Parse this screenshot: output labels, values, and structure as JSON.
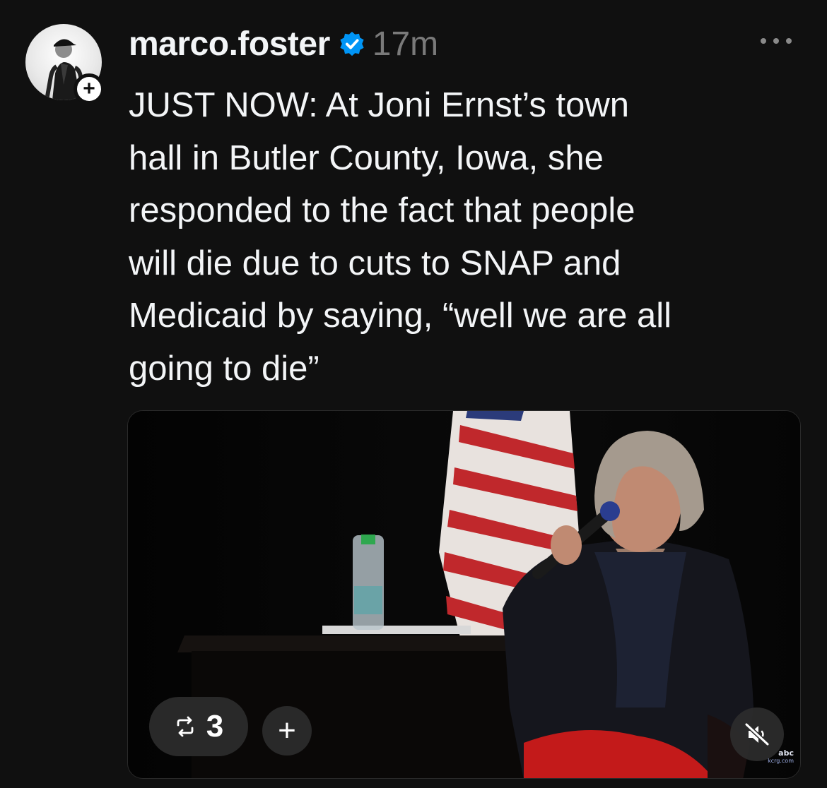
{
  "author": {
    "username": "marco.foster",
    "verified": true,
    "time": "17m",
    "avatar_icon": "user-avatar",
    "follow_icon": "plus-icon"
  },
  "post": {
    "text": "JUST NOW: At Joni Ernst’s town\nhall in Butler County, Iowa, she\nresponded to the fact that people\nwill die due to cuts to SNAP and\nMedicaid by saying, “well we are all\ngoing to die”"
  },
  "media": {
    "type": "video",
    "repost_count": "3",
    "repost_icon": "repost-icon",
    "add_icon": "plus-icon",
    "mute_icon": "speaker-muted-icon",
    "watermark_network": "abc",
    "watermark_station": "kcrg.com"
  },
  "menu": {
    "more_icon": "more-horizontal-icon"
  },
  "colors": {
    "background": "#101010",
    "text": "#f3f5f7",
    "muted": "#7a7a7a",
    "verified_blue": "#0095f6"
  }
}
